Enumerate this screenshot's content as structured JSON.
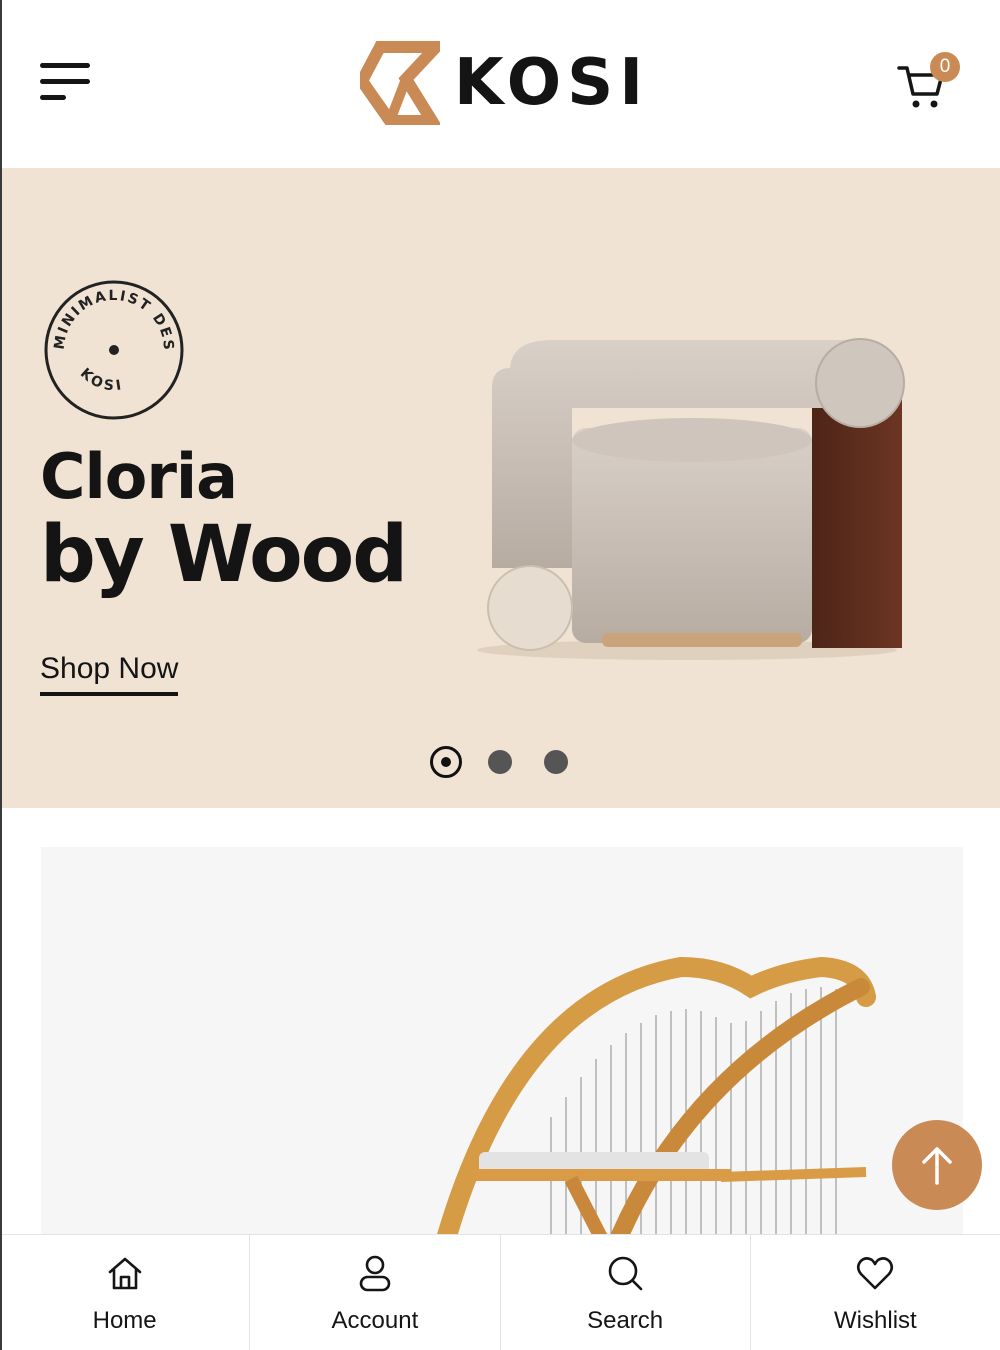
{
  "header": {
    "brand": "KOSI",
    "cart_count": "0",
    "accent_color": "#c98a55"
  },
  "hero": {
    "stamp_top_text": "MINIMALIST DESIGN",
    "stamp_bottom_text": "KOSI",
    "title_line1": "Cloria",
    "title_line2": "by Wood",
    "cta": "Shop Now",
    "background": "#f0e3d4",
    "slides_total": 3,
    "active_slide": 1
  },
  "bottom_nav": {
    "items": [
      {
        "label": "Home",
        "icon": "home-icon"
      },
      {
        "label": "Account",
        "icon": "user-icon"
      },
      {
        "label": "Search",
        "icon": "search-icon"
      },
      {
        "label": "Wishlist",
        "icon": "heart-icon"
      }
    ]
  }
}
